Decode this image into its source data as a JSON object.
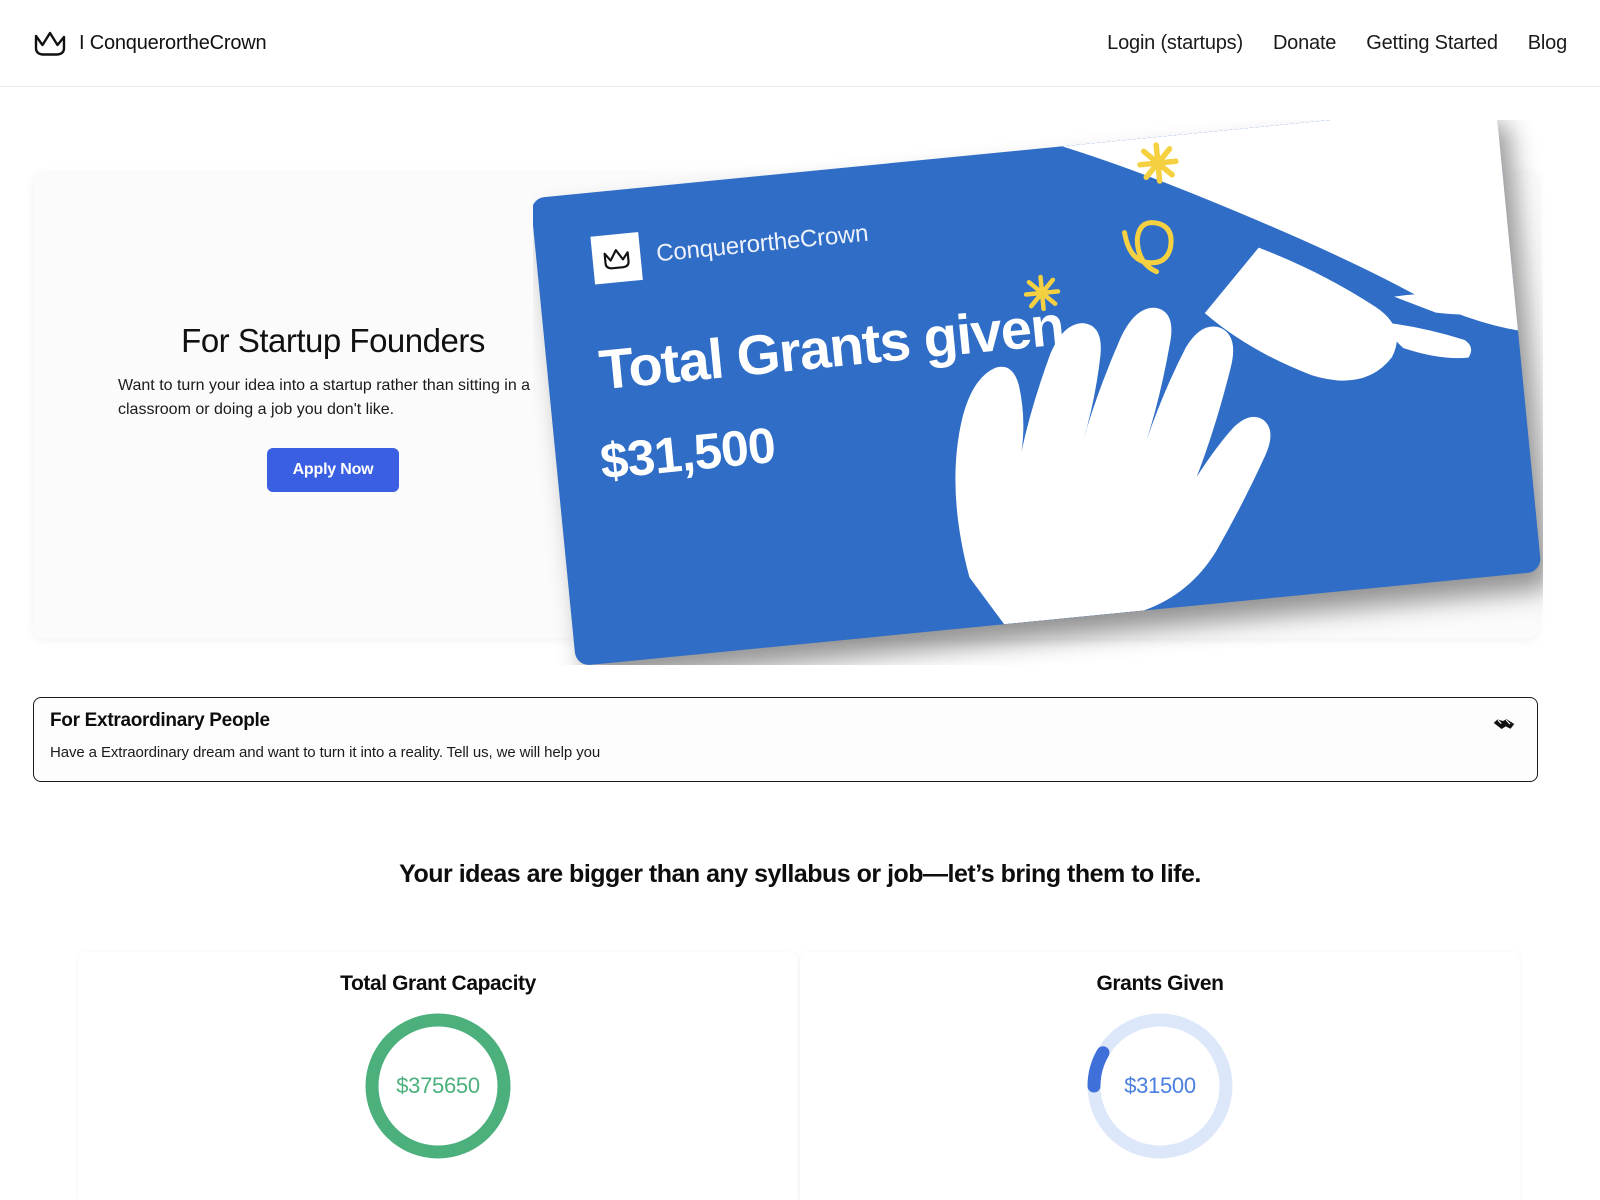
{
  "header": {
    "brand_name": "I ConquerortheCrown",
    "logo_icon": "crown-icon",
    "nav": [
      {
        "label": "Login (startups)"
      },
      {
        "label": "Donate"
      },
      {
        "label": "Getting Started"
      },
      {
        "label": "Blog"
      }
    ]
  },
  "hero": {
    "title": "For Startup Founders",
    "subtitle": "Want to turn your idea into a startup rather than sitting in a classroom or doing a job you don't like.",
    "cta_label": "Apply Now",
    "cta_color": "#3b5fe2",
    "promo": {
      "brand_name": "ConquerortheCrown",
      "logo_icon": "crown-icon",
      "headline": "Total Grants given",
      "amount": "$31,500",
      "card_color": "#2f6dc6",
      "accent_color": "#f5d142",
      "art": "two-hands-reaching-illustration"
    }
  },
  "extraordinary": {
    "title": "For Extraordinary People",
    "subtitle": "Have a Extraordinary dream and want to turn it into a reality. Tell us, we will help you",
    "icon": "handshake-icon"
  },
  "section": {
    "headline": "Your ideas are bigger than any syllabus or job—let’s bring them to life."
  },
  "chart_data": [
    {
      "type": "pie",
      "title": "Total Grant Capacity",
      "value_label": "$375650",
      "value": 375650,
      "percent": 100,
      "ring_color": "#4cb07c",
      "track_color": "#ffffff",
      "label_color": "#4cb07c"
    },
    {
      "type": "pie",
      "title": "Grants Given",
      "value_label": "$31500",
      "value": 31500,
      "percent": 8.4,
      "ring_color": "#3f6fd8",
      "track_color": "#dde7fa",
      "label_color": "#4a7fe0"
    }
  ]
}
